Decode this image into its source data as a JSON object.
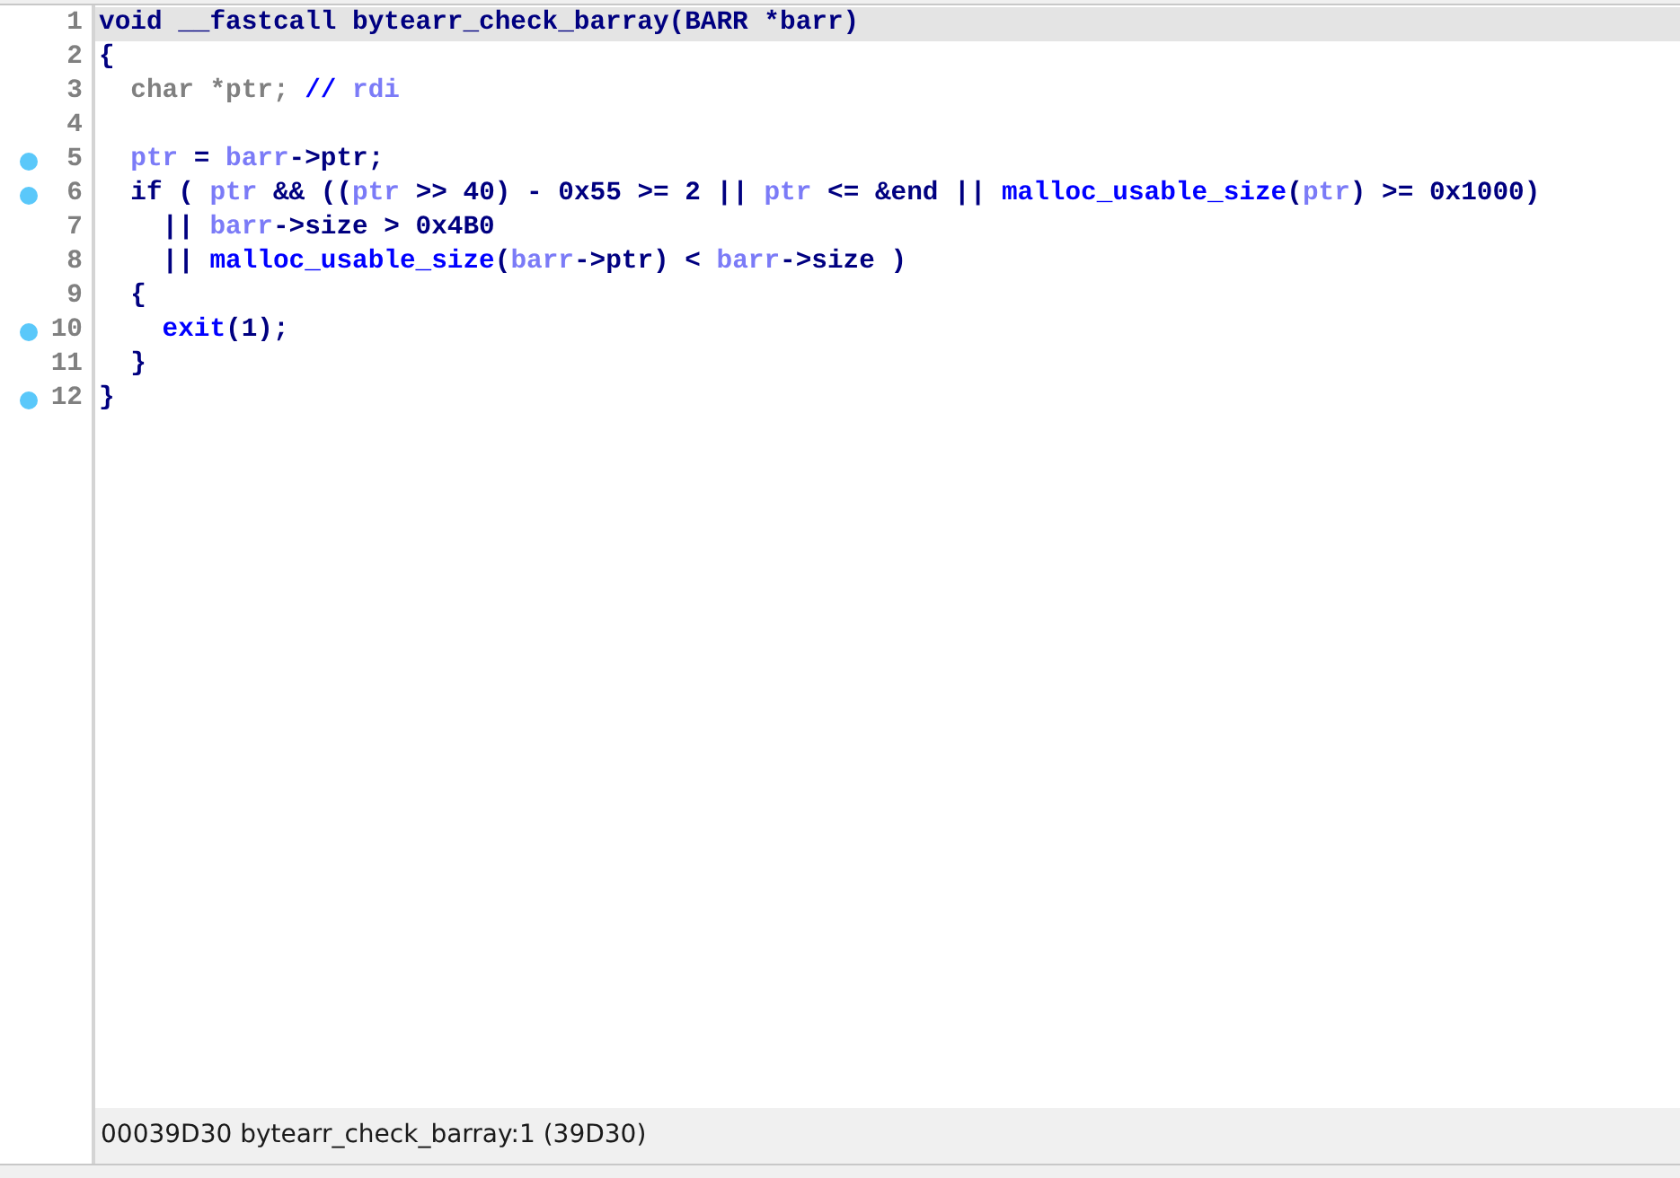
{
  "code_lines": [
    {
      "number": "1",
      "breakpoint": false,
      "current": true,
      "tokens": [
        {
          "kind": "plain",
          "text": "void __fastcall bytearr_check_barray(BARR *barr)"
        }
      ]
    },
    {
      "number": "2",
      "breakpoint": false,
      "current": false,
      "tokens": [
        {
          "kind": "plain",
          "text": "{"
        }
      ]
    },
    {
      "number": "3",
      "breakpoint": false,
      "current": false,
      "tokens": [
        {
          "kind": "decl",
          "text": "  char *ptr; "
        },
        {
          "kind": "comment",
          "text": "// "
        },
        {
          "kind": "var",
          "text": "rdi"
        }
      ]
    },
    {
      "number": "4",
      "breakpoint": false,
      "current": false
    },
    {
      "number": "5",
      "breakpoint": true,
      "current": false,
      "tokens": [
        {
          "kind": "var",
          "text": "  ptr"
        },
        {
          "kind": "plain",
          "text": " = "
        },
        {
          "kind": "var",
          "text": "barr"
        },
        {
          "kind": "plain",
          "text": "->ptr;"
        }
      ]
    },
    {
      "number": "6",
      "breakpoint": true,
      "current": false,
      "tokens": [
        {
          "kind": "plain",
          "text": "  if ( "
        },
        {
          "kind": "var",
          "text": "ptr"
        },
        {
          "kind": "plain",
          "text": " && (("
        },
        {
          "kind": "var",
          "text": "ptr"
        },
        {
          "kind": "plain",
          "text": " >> 40) - 0x55 >= 2 || "
        },
        {
          "kind": "var",
          "text": "ptr"
        },
        {
          "kind": "plain",
          "text": " <= &end || "
        },
        {
          "kind": "func",
          "text": "malloc_usable_size"
        },
        {
          "kind": "plain",
          "text": "("
        },
        {
          "kind": "var",
          "text": "ptr"
        },
        {
          "kind": "plain",
          "text": ") >= 0x1000)"
        }
      ]
    },
    {
      "number": "7",
      "breakpoint": false,
      "current": false,
      "tokens": [
        {
          "kind": "plain",
          "text": "    || "
        },
        {
          "kind": "var",
          "text": "barr"
        },
        {
          "kind": "plain",
          "text": "->size > 0x4B0"
        }
      ]
    },
    {
      "number": "8",
      "breakpoint": false,
      "current": false,
      "tokens": [
        {
          "kind": "plain",
          "text": "    || "
        },
        {
          "kind": "func",
          "text": "malloc_usable_size"
        },
        {
          "kind": "plain",
          "text": "("
        },
        {
          "kind": "var",
          "text": "barr"
        },
        {
          "kind": "plain",
          "text": "->ptr) < "
        },
        {
          "kind": "var",
          "text": "barr"
        },
        {
          "kind": "plain",
          "text": "->size )"
        }
      ]
    },
    {
      "number": "9",
      "breakpoint": false,
      "current": false,
      "tokens": [
        {
          "kind": "plain",
          "text": "  {"
        }
      ]
    },
    {
      "number": "10",
      "breakpoint": true,
      "current": false,
      "tokens": [
        {
          "kind": "func",
          "text": "    exit"
        },
        {
          "kind": "plain",
          "text": "(1);"
        }
      ]
    },
    {
      "number": "11",
      "breakpoint": false,
      "current": false,
      "tokens": [
        {
          "kind": "plain",
          "text": "  }"
        }
      ]
    },
    {
      "number": "12",
      "breakpoint": true,
      "current": false,
      "tokens": [
        {
          "kind": "plain",
          "text": "}"
        }
      ]
    }
  ],
  "status_bar": "00039D30 bytearr_check_barray:1 (39D30)"
}
